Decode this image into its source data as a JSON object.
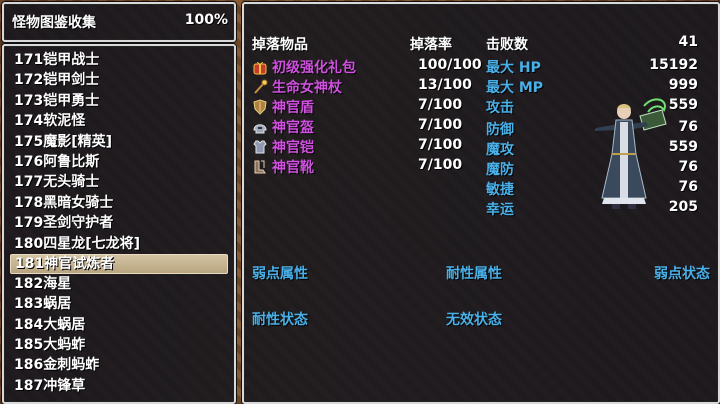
{
  "title": {
    "label": "怪物图鉴收集",
    "percent": "100%"
  },
  "monster_list": [
    "171铠甲战士",
    "172铠甲剑士",
    "173铠甲勇士",
    "174软泥怪",
    "175魔影[精英]",
    "176阿鲁比斯",
    "177无头骑士",
    "178黑暗女骑士",
    "179圣剑守护者",
    "180四星龙[七龙将]",
    "181神官试炼者",
    "182海星",
    "183蜗居",
    "184大蜗居",
    "185大蚂蚱",
    "186金刺蚂蚱",
    "187冲锋草"
  ],
  "selected_index": 10,
  "detail": {
    "drop_header": "掉落物品",
    "rate_header": "掉落率",
    "kills_label": "击败数",
    "kills_value": "41",
    "drops": [
      {
        "name": "初级强化礼包",
        "rate": "100/100",
        "icon": "gift-bag-icon"
      },
      {
        "name": "生命女神杖",
        "rate": "13/100",
        "icon": "staff-icon"
      },
      {
        "name": "神官盾",
        "rate": "7/100",
        "icon": "shield-icon"
      },
      {
        "name": "神官盔",
        "rate": "7/100",
        "icon": "helmet-icon"
      },
      {
        "name": "神官铠",
        "rate": "7/100",
        "icon": "armor-icon"
      },
      {
        "name": "神官靴",
        "rate": "7/100",
        "icon": "boots-icon"
      }
    ],
    "stats": [
      {
        "label": "最大 HP",
        "value": "15192"
      },
      {
        "label": "最大 MP",
        "value": "999"
      },
      {
        "label": "攻击",
        "value": "559"
      },
      {
        "label": "防御",
        "value": "76"
      },
      {
        "label": "魔攻",
        "value": "559"
      },
      {
        "label": "魔防",
        "value": "76"
      },
      {
        "label": "敏捷",
        "value": "76"
      },
      {
        "label": "幸运",
        "value": "205"
      }
    ],
    "sections": {
      "weak_attr": "弱点属性",
      "resist_attr": "耐性属性",
      "weak_state": "弱点状态",
      "resist_state": "耐性状态",
      "immune_state": "无效状态"
    }
  },
  "colors": {
    "accent_blue": "#4ab0e8",
    "drop_purple": "#d050e0",
    "window_bg": "#14161e",
    "selection": "#c8b894"
  }
}
